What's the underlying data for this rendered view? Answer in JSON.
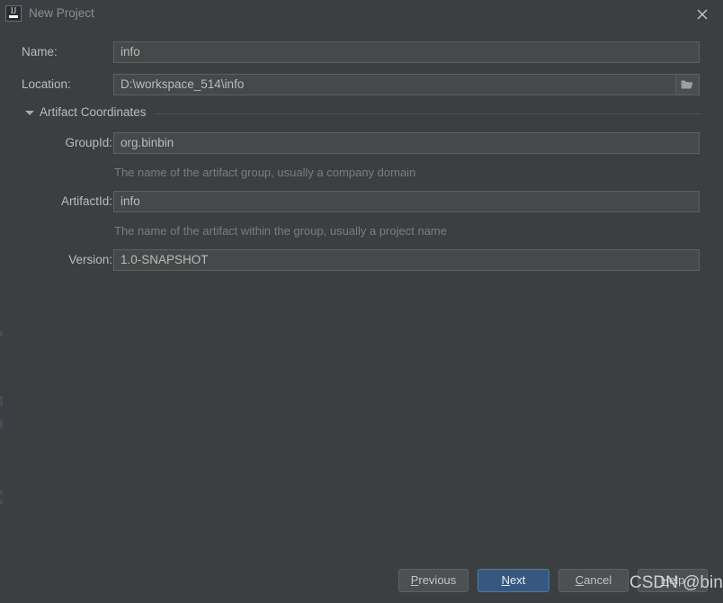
{
  "window": {
    "title": "New Project",
    "app_icon": "intellij-idea-icon",
    "app_icon_text": "IJ",
    "close_icon": "close-icon"
  },
  "form": {
    "name": {
      "label": "Name:",
      "value": "info"
    },
    "location": {
      "label": "Location:",
      "value": "D:\\workspace_514\\info",
      "browse_icon": "folder-icon"
    },
    "section": {
      "label": "Artifact Coordinates",
      "expanded": true,
      "toggle_icon": "triangle-down-icon"
    },
    "group_id": {
      "label": "GroupId:",
      "value": "org.binbin",
      "hint": "The name of the artifact group, usually a company domain"
    },
    "artifact_id": {
      "label": "ArtifactId:",
      "value": "info",
      "hint": "The name of the artifact within the group, usually a project name"
    },
    "version": {
      "label": "Version:",
      "value": "1.0-SNAPSHOT"
    }
  },
  "buttons": {
    "previous": {
      "pre": "P",
      "mnemonic": "",
      "label": "Previous",
      "mn_index": 0
    },
    "next": {
      "label": "Next",
      "mn_index": 0
    },
    "cancel": {
      "label": "Cancel"
    },
    "help": {
      "label": "Help"
    }
  },
  "watermark": {
    "text": "CSDN @binbinxyz"
  },
  "colors": {
    "dialog_bg": "#3c3f41",
    "field_bg": "#45494a",
    "field_border": "#5e6060",
    "text": "#bbbbbb",
    "hint_text": "#7a7d7f",
    "title_text": "#8c8f91",
    "primary_button_bg": "#365880",
    "primary_button_border": "#4a7ab0",
    "button_bg": "#4c5052",
    "accent": "#3d7ab5"
  }
}
